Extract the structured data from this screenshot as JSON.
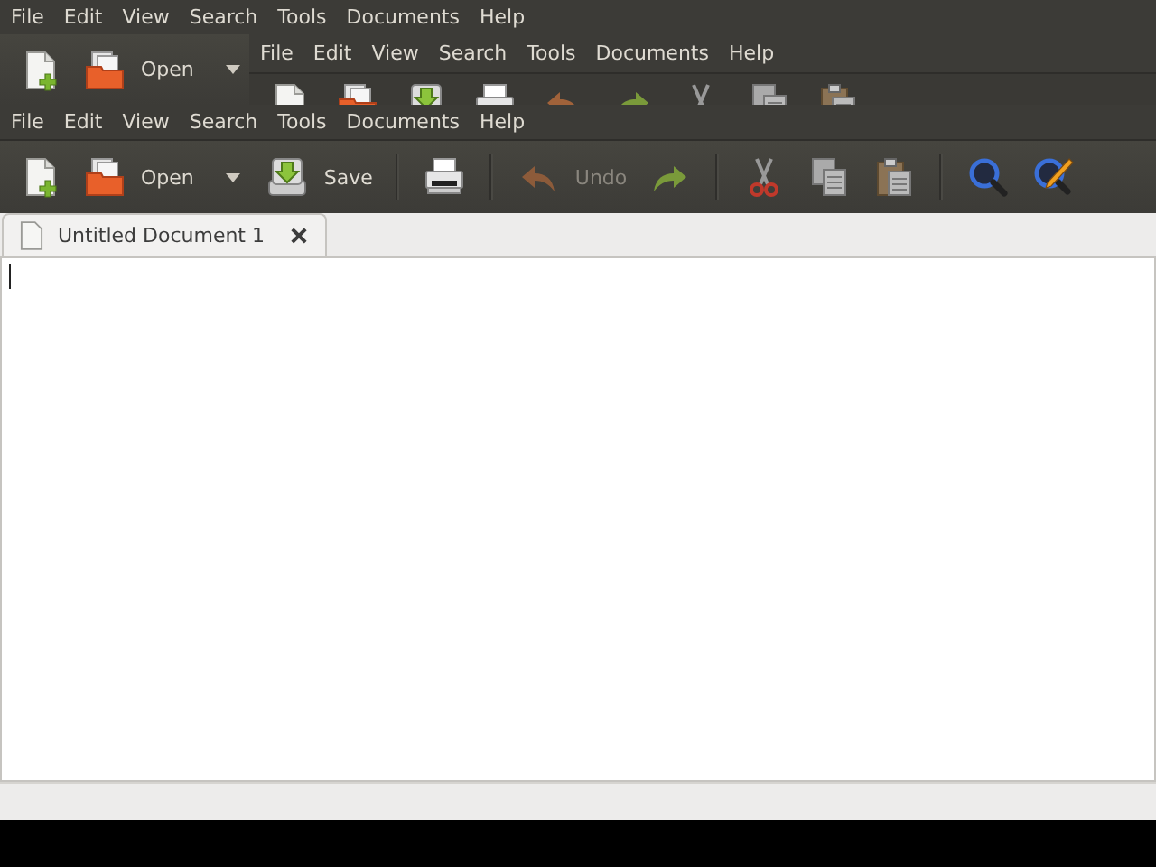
{
  "ghost": {
    "menubar": [
      "File",
      "Edit",
      "View",
      "Search",
      "Tools",
      "Documents",
      "Help"
    ],
    "toolbar": [
      {
        "kind": "new"
      },
      {
        "kind": "open",
        "label": "Open",
        "menu": true
      }
    ],
    "inner_menubar": [
      "File",
      "Edit",
      "View",
      "Search",
      "Tools",
      "Documents",
      "Help"
    ],
    "inner_toolbar": [
      {
        "kind": "new"
      },
      {
        "kind": "open"
      },
      {
        "kind": "save"
      },
      {
        "kind": "print"
      },
      {
        "kind": "undo"
      },
      {
        "kind": "redo"
      },
      {
        "kind": "cut"
      },
      {
        "kind": "copy"
      },
      {
        "kind": "paste"
      }
    ]
  },
  "menubar": [
    "File",
    "Edit",
    "View",
    "Search",
    "Tools",
    "Documents",
    "Help"
  ],
  "toolbar": [
    {
      "kind": "new",
      "disabled": false
    },
    {
      "kind": "open",
      "label": "Open",
      "menu": true,
      "disabled": false
    },
    {
      "kind": "save",
      "label": "Save",
      "disabled": false
    },
    {
      "kind": "separator"
    },
    {
      "kind": "print",
      "disabled": false
    },
    {
      "kind": "separator"
    },
    {
      "kind": "undo",
      "label": "Undo",
      "disabled": true
    },
    {
      "kind": "redo",
      "disabled": false
    },
    {
      "kind": "separator"
    },
    {
      "kind": "cut",
      "disabled": false
    },
    {
      "kind": "copy",
      "disabled": false
    },
    {
      "kind": "paste",
      "disabled": false
    },
    {
      "kind": "separator"
    },
    {
      "kind": "find",
      "disabled": false
    },
    {
      "kind": "replace",
      "disabled": false
    }
  ],
  "tabs": [
    {
      "label": "Untitled Document 1",
      "selected": true
    }
  ]
}
